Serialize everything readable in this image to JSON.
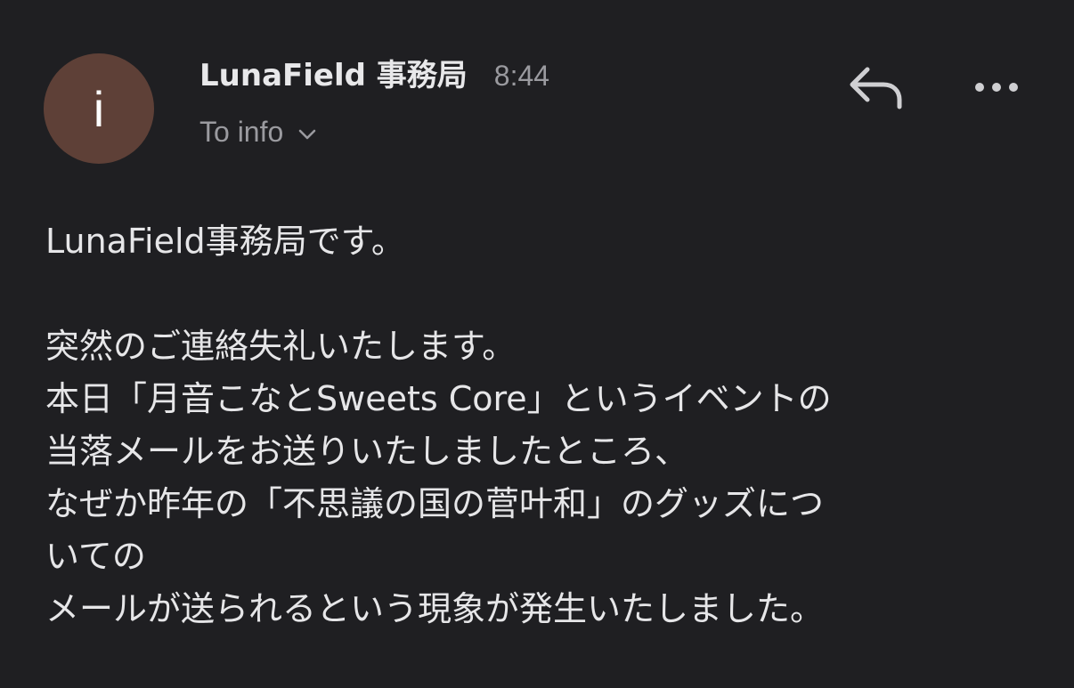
{
  "sender": {
    "avatar_letter": "i",
    "avatar_color": "#5e4037",
    "name": "LunaField 事務局",
    "time": "8:44"
  },
  "recipient": {
    "label": "To info"
  },
  "icons": {
    "reply": "reply-arrow-icon",
    "more": "more-horizontal-dots-icon",
    "expand": "chevron-down-icon"
  },
  "body": {
    "greeting": "LunaField事務局です。",
    "lines": [
      "突然のご連絡失礼いたします。",
      "本日「月音こなとSweets Core」というイベントの",
      "当落メールをお送りいたしましたところ、",
      "なぜか昨年の「不思議の国の菅叶和」のグッズにつ",
      "いての",
      "メールが送られるという現象が発生いたしました。"
    ]
  },
  "colors": {
    "background": "#1f1f22",
    "primary_text": "#e6e6e8",
    "secondary_text": "#9a9a9f"
  }
}
